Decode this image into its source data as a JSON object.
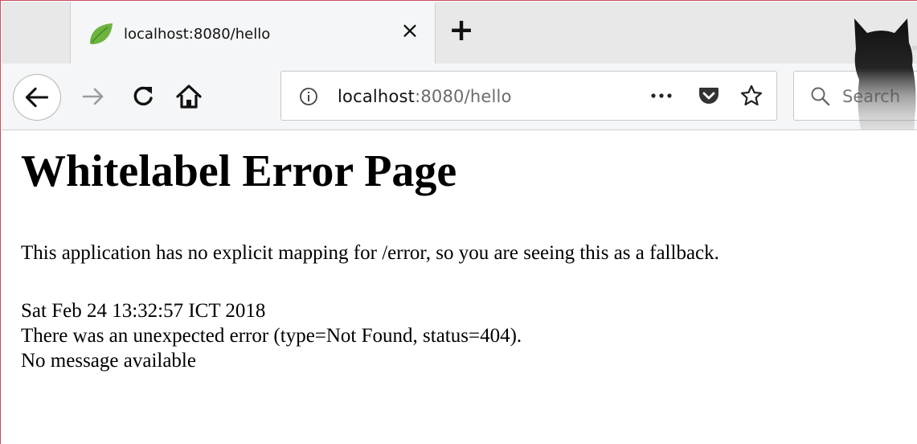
{
  "browser": {
    "tab": {
      "title": "localhost:8080/hello",
      "close_glyph": "×",
      "favicon": "spring-leaf-icon"
    },
    "new_tab_glyph": "+",
    "nav": {
      "back": "back-arrow-icon",
      "forward": "forward-arrow-icon",
      "reload": "reload-icon",
      "home": "home-icon"
    },
    "urlbar": {
      "host": "localhost",
      "rest": ":8080/hello",
      "more_glyph": "•••"
    },
    "search": {
      "placeholder": "Search"
    },
    "colors": {
      "accent_border": "#c94a5e",
      "favicon_green": "#6db33f"
    }
  },
  "page": {
    "title": "Whitelabel Error Page",
    "fallback_message": "This application has no explicit mapping for /error, so you are seeing this as a fallback.",
    "timestamp": "Sat Feb 24 13:32:57 ICT 2018",
    "error_detail": "There was an unexpected error (type=Not Found, status=404).",
    "message": "No message available"
  }
}
